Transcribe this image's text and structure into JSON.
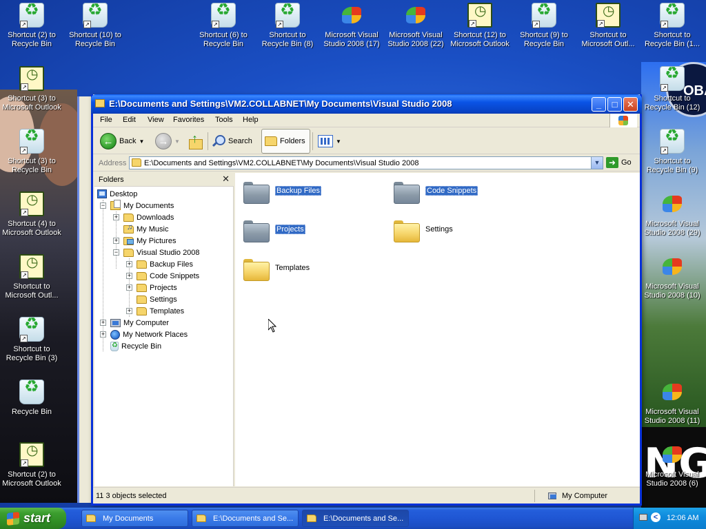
{
  "desktop": {
    "icons": [
      {
        "label": "Shortcut (2) to Recycle Bin",
        "kind": "recycle",
        "icon": "recycle-bin-icon"
      },
      {
        "label": "Shortcut (10) to Recycle Bin",
        "kind": "recycle",
        "icon": "recycle-bin-icon"
      },
      {
        "label": "Shortcut (6) to Recycle Bin",
        "kind": "recycle",
        "icon": "recycle-bin-icon"
      },
      {
        "label": "Shortcut to Recycle Bin (8)",
        "kind": "recycle",
        "icon": "recycle-bin-icon"
      },
      {
        "label": "Microsoft Visual Studio 2008 (17)",
        "kind": "vs",
        "icon": "visual-studio-icon"
      },
      {
        "label": "Microsoft Visual Studio 2008 (22)",
        "kind": "vs",
        "icon": "visual-studio-icon"
      },
      {
        "label": "Shortcut (12) to Microsoft Outlook",
        "kind": "outlook",
        "icon": "outlook-icon"
      },
      {
        "label": "Shortcut (9) to Recycle Bin",
        "kind": "recycle",
        "icon": "recycle-bin-icon"
      },
      {
        "label": "Shortcut to Microsoft Outl...",
        "kind": "outlook",
        "icon": "outlook-icon"
      },
      {
        "label": "Shortcut to Recycle Bin (1...",
        "kind": "recycle",
        "icon": "recycle-bin-icon"
      },
      {
        "label": "Shortcut (3) to Microsoft Outlook",
        "kind": "outlook",
        "icon": "outlook-icon"
      },
      {
        "label": "Shortcut to Recycle Bin (12)",
        "kind": "recycle",
        "icon": "recycle-bin-icon"
      },
      {
        "label": "Shortcut (3) to Recycle Bin",
        "kind": "recycle",
        "icon": "recycle-bin-icon"
      },
      {
        "label": "Shortcut to Recycle Bin (9)",
        "kind": "recycle",
        "icon": "recycle-bin-icon"
      },
      {
        "label": "Shortcut (4) to Microsoft Outlook",
        "kind": "outlook",
        "icon": "outlook-icon"
      },
      {
        "label": "Microsoft Visual Studio 2008 (29)",
        "kind": "vs",
        "icon": "visual-studio-icon"
      },
      {
        "label": "Shortcut to Microsoft Outl...",
        "kind": "outlook",
        "icon": "outlook-icon"
      },
      {
        "label": "Microsoft Visual Studio 2008 (10)",
        "kind": "vs",
        "icon": "visual-studio-icon"
      },
      {
        "label": "Shortcut to Recycle Bin (3)",
        "kind": "recycle",
        "icon": "recycle-bin-icon"
      },
      {
        "label": "Recycle Bin",
        "kind": "recycle",
        "icon": "recycle-bin-icon"
      },
      {
        "label": "Microsoft Visual Studio 2008 (11)",
        "kind": "vs",
        "icon": "visual-studio-icon"
      },
      {
        "label": "Shortcut (2) to Microsoft Outlook",
        "kind": "outlook",
        "icon": "outlook-icon"
      },
      {
        "label": "Microsoft Visual Studio 2008 (6)",
        "kind": "vs",
        "icon": "visual-studio-icon"
      }
    ],
    "wallpaper_text": "OBA",
    "wallpaper_text2": "NG"
  },
  "window": {
    "title": "E:\\Documents and Settings\\VM2.COLLABNET\\My Documents\\Visual Studio 2008",
    "menu": [
      "File",
      "Edit",
      "View",
      "Favorites",
      "Tools",
      "Help"
    ],
    "toolbar": {
      "back": "Back",
      "search": "Search",
      "folders": "Folders"
    },
    "address": {
      "label": "Address",
      "value": "E:\\Documents and Settings\\VM2.COLLABNET\\My Documents\\Visual Studio 2008",
      "go": "Go"
    },
    "folders_pane": {
      "title": "Folders",
      "tree": [
        {
          "label": "Desktop",
          "icon": "desktop-icon",
          "depth": 0
        },
        {
          "label": "My Documents",
          "icon": "my-documents-icon",
          "depth": 1
        },
        {
          "label": "Downloads",
          "icon": "folder-icon",
          "depth": 2
        },
        {
          "label": "My Music",
          "icon": "my-music-icon",
          "depth": 2
        },
        {
          "label": "My Pictures",
          "icon": "my-pictures-icon",
          "depth": 2
        },
        {
          "label": "Visual Studio 2008",
          "icon": "folder-open-icon",
          "depth": 2
        },
        {
          "label": "Backup Files",
          "icon": "folder-icon",
          "depth": 3
        },
        {
          "label": "Code Snippets",
          "icon": "folder-icon",
          "depth": 3
        },
        {
          "label": "Projects",
          "icon": "folder-icon",
          "depth": 3
        },
        {
          "label": "Settings",
          "icon": "folder-icon",
          "depth": 3
        },
        {
          "label": "Templates",
          "icon": "folder-icon",
          "depth": 3
        },
        {
          "label": "My Computer",
          "icon": "my-computer-icon",
          "depth": 1
        },
        {
          "label": "My Network Places",
          "icon": "network-places-icon",
          "depth": 1
        },
        {
          "label": "Recycle Bin",
          "icon": "recycle-bin-icon",
          "depth": 1
        }
      ]
    },
    "items": [
      {
        "label": "Backup Files",
        "selected": true
      },
      {
        "label": "Code Snippets",
        "selected": true
      },
      {
        "label": "Projects",
        "selected": true
      },
      {
        "label": "Settings",
        "selected": false
      },
      {
        "label": "Templates",
        "selected": false
      }
    ],
    "status": {
      "left_cut": "11",
      "selection": "3 objects selected",
      "zone": "My Computer"
    }
  },
  "taskbar": {
    "start": "start",
    "tasks": [
      {
        "label": "My Documents",
        "active": false
      },
      {
        "label": "E:\\Documents and Se...",
        "active": false
      },
      {
        "label": "E:\\Documents and Se...",
        "active": true
      }
    ],
    "clock": "12:06 AM"
  }
}
